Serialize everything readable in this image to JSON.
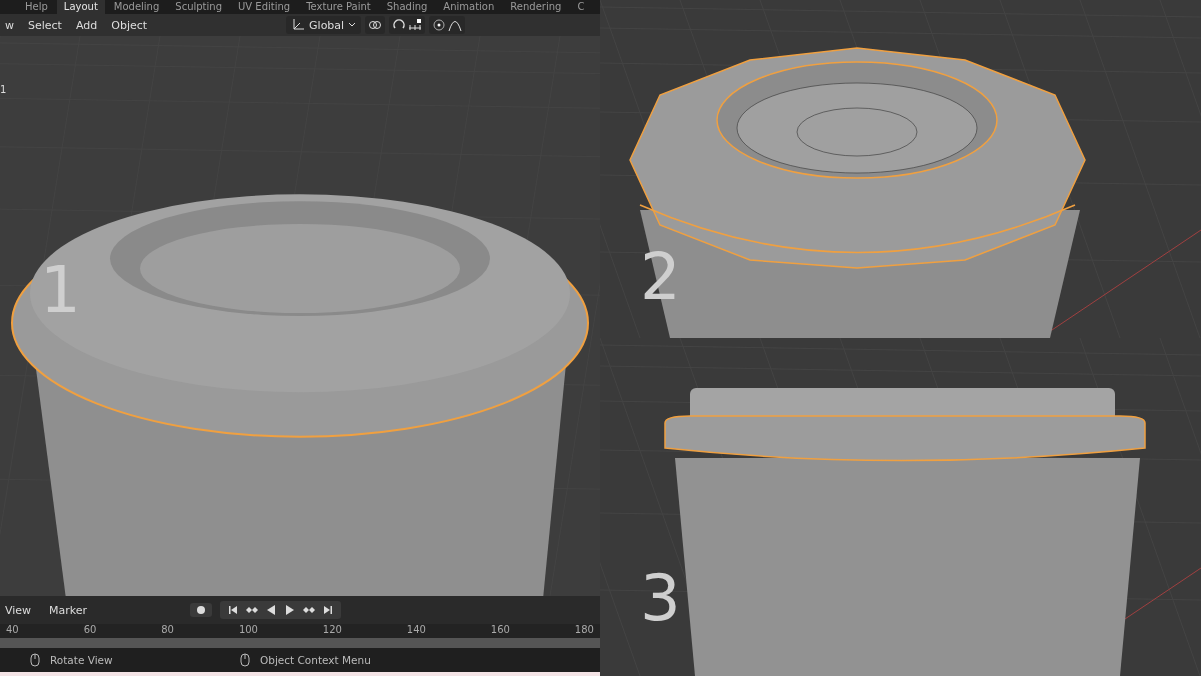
{
  "left_panel": {
    "workspace_tabs": [
      {
        "label": "Help",
        "selected": false
      },
      {
        "label": "Layout",
        "selected": true
      },
      {
        "label": "Modeling",
        "selected": false
      },
      {
        "label": "Sculpting",
        "selected": false
      },
      {
        "label": "UV Editing",
        "selected": false
      },
      {
        "label": "Texture Paint",
        "selected": false
      },
      {
        "label": "Shading",
        "selected": false
      },
      {
        "label": "Animation",
        "selected": false
      },
      {
        "label": "Rendering",
        "selected": false
      },
      {
        "label": "C",
        "selected": false
      }
    ],
    "header_menus": [
      "w",
      "Select",
      "Add",
      "Object"
    ],
    "transform_orientation": "Global",
    "collection_label": "1",
    "step_number": "1",
    "timeline": {
      "menus": [
        "View",
        "Marker"
      ],
      "ticks": [
        "40",
        "60",
        "80",
        "100",
        "120",
        "140",
        "160",
        "180"
      ]
    },
    "status_bar": [
      {
        "text": "Rotate View"
      },
      {
        "text": "Object Context Menu"
      }
    ]
  },
  "right_panels": [
    {
      "step_number": "2",
      "kind": "top"
    },
    {
      "step_number": "3",
      "kind": "side"
    }
  ]
}
